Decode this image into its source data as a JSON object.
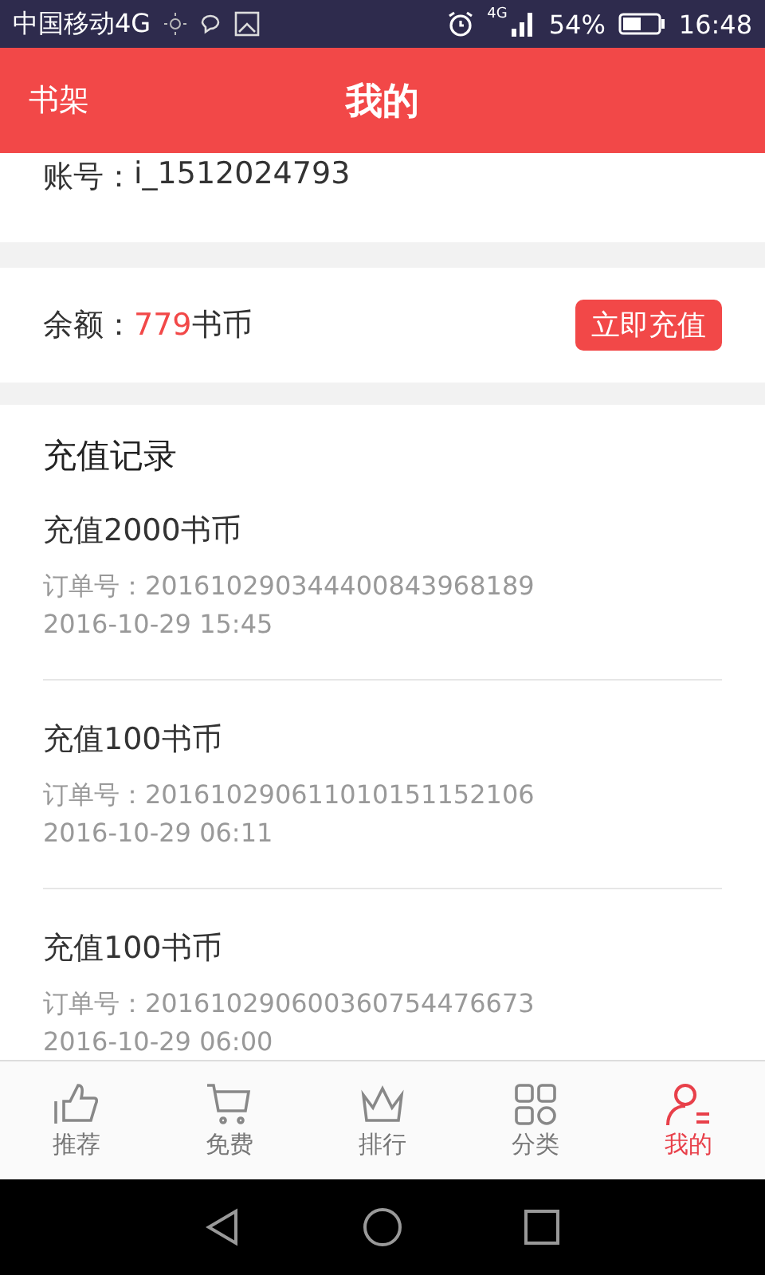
{
  "status_bar": {
    "carrier": "中国移动4G",
    "network": "4G",
    "battery": "54%",
    "time": "16:48"
  },
  "header": {
    "back": "书架",
    "title": "我的"
  },
  "account": {
    "label": "账号：",
    "value": "i_1512024793"
  },
  "balance": {
    "label": "余额：",
    "amount": "779",
    "unit": "书币",
    "button": "立即充值"
  },
  "records": {
    "title": "充值记录",
    "items": [
      {
        "title": "充值2000书币",
        "order": "订单号：201610290344400843968189",
        "time": "2016-10-29 15:45"
      },
      {
        "title": "充值100书币",
        "order": "订单号：201610290611010151152106",
        "time": "2016-10-29 06:11"
      },
      {
        "title": "充值100书币",
        "order": "订单号：201610290600360754476673",
        "time": "2016-10-29 06:00"
      }
    ]
  },
  "tabs": [
    {
      "kind": "thumb",
      "label": "推荐",
      "selected": false
    },
    {
      "kind": "cart",
      "label": "免费",
      "selected": false
    },
    {
      "kind": "crown",
      "label": "排行",
      "selected": false
    },
    {
      "kind": "grid",
      "label": "分类",
      "selected": false
    },
    {
      "kind": "person",
      "label": "我的",
      "selected": true
    }
  ]
}
